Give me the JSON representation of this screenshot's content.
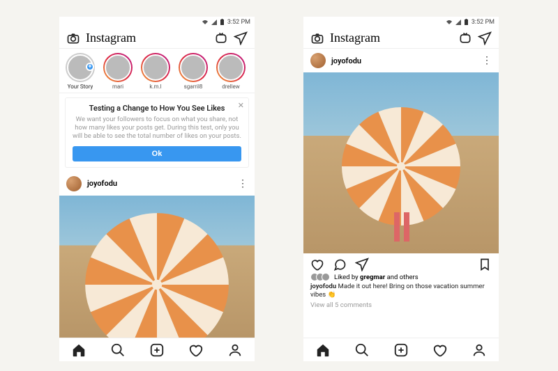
{
  "status": {
    "time": "3:52 PM"
  },
  "header": {
    "brand": "Instagram"
  },
  "stories": [
    {
      "label": "Your Story",
      "own": true
    },
    {
      "label": "mari"
    },
    {
      "label": "k.m.l"
    },
    {
      "label": "sgarril8"
    },
    {
      "label": "drellew"
    }
  ],
  "notice": {
    "title": "Testing a Change to How You See Likes",
    "body": "We want your followers to focus on what you share, not how many likes your posts get. During this test, only you will be able to see the total number of likes on your posts.",
    "ok": "Ok"
  },
  "post": {
    "username": "joyofodu",
    "liked_by_prefix": "Liked by ",
    "liked_by_name": "gregmar",
    "liked_by_suffix": " and others",
    "caption_user": "joyofodu",
    "caption_text": " Made it out here! Bring on those vacation summer vibes ",
    "caption_emoji": "👏",
    "view_all": "View all 5 comments"
  }
}
